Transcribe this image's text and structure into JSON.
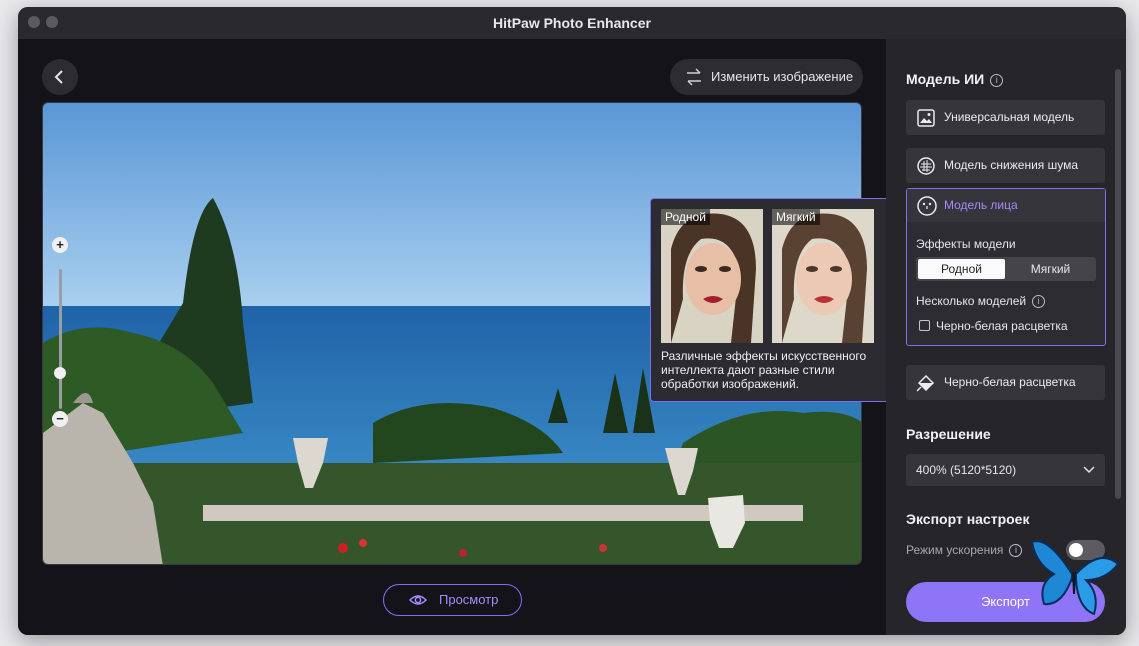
{
  "window": {
    "title": "HitPaw Photo Enhancer"
  },
  "toolbar": {
    "change_image_label": "Изменить изображение",
    "preview_label": "Просмотр"
  },
  "tooltip": {
    "original_label": "Родной",
    "soft_label": "Мягкий",
    "text": "Различные эффекты искусственного интеллекта дают разные стили обработки изображений."
  },
  "sidebar": {
    "ai_model_title": "Модель ИИ",
    "models": {
      "universal": "Универсальная модель",
      "denoise": "Модель снижения шума",
      "face": "Модель лица",
      "colorize": "Черно-белая расцветка"
    },
    "face_panel": {
      "effects_label": "Эффекты модели",
      "effect_original": "Родной",
      "effect_soft": "Мягкий",
      "multi_models_label": "Несколько моделей",
      "bw_checkbox_label": "Черно-белая расцветка",
      "bw_checked": false
    },
    "resolution_title": "Разрешение",
    "resolution_value": "400% (5120*5120)",
    "export_settings_title": "Экспорт настроек",
    "acceleration_label": "Режим ускорения",
    "acceleration_on": false,
    "export_button": "Экспорт"
  },
  "colors": {
    "accent": "#8e74f6",
    "panel": "#262529",
    "background": "#14131a"
  }
}
